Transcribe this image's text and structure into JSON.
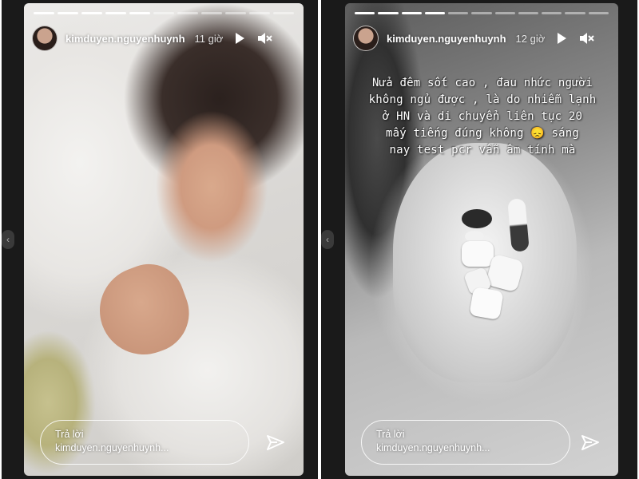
{
  "stories": [
    {
      "username": "kimduyen.nguyenhuynh",
      "time": "11 giờ",
      "caption": "",
      "reply_label": "Trả lời",
      "reply_user": "kimduyen.nguyenhuynh...",
      "progress": {
        "total": 11,
        "done": 5
      },
      "icons": [
        "play-icon",
        "volume-muted-icon",
        "send-icon"
      ]
    },
    {
      "username": "kimduyen.nguyenhuynh",
      "time": "12 giờ",
      "caption": "Nửa đêm sốt cao , đau nhức người\nkhông ngủ được , là do nhiễm lạnh\nở HN và di chuyển liên tục 20\nmấy tiếng đúng không 😞 sáng\nnay test pcr vẫn âm tính mà",
      "reply_label": "Trả lời",
      "reply_user": "kimduyen.nguyenhuynh...",
      "progress": {
        "total": 11,
        "done": 4
      },
      "icons": [
        "play-icon",
        "volume-muted-icon",
        "send-icon"
      ]
    }
  ],
  "colors": {
    "text": "#ffffff",
    "panel_bg": "#1a1a1a",
    "page_bg": "#ffffff"
  }
}
